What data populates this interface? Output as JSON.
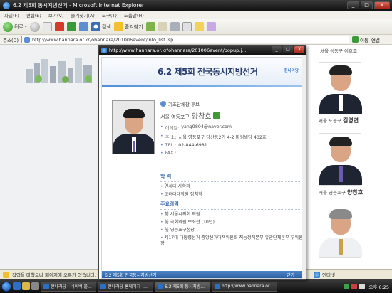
{
  "window": {
    "title": "6.2 제5회 동시지방선거 - Microsoft Internet Explorer",
    "controls": [
      "_",
      "□",
      "X"
    ]
  },
  "menu": [
    "파일(F)",
    "편집(E)",
    "보기(V)",
    "즐겨찾기(A)",
    "도구(T)",
    "도움말(H)"
  ],
  "toolbar": {
    "back_label": "뒤로",
    "search_label": "검색",
    "favorites_label": "즐겨찾기"
  },
  "address": {
    "label": "주소(D)",
    "url": "http://www.hannara.or.kr/ohannara/201006event/info_list.jsp",
    "go_label": "이동",
    "links_label": "연결"
  },
  "right_panel": {
    "top_caption": "서울 성동구 이호조",
    "candidates": [
      {
        "region": "서울 도봉구",
        "name": "김영련"
      },
      {
        "region": "서울 영등포구",
        "name": "양창호"
      },
      {
        "region": "",
        "name": ""
      }
    ]
  },
  "status": {
    "text": "작업을 마쳤으나 페이지에 오류가 있습니다.",
    "zone": "인터넷"
  },
  "taskbar": {
    "tasks": [
      "한나라당 - 네이버 블...",
      "한나라당 홈페이지 -...",
      "6.2 제5회 동시지방...",
      "http://www.hannara.or..."
    ],
    "clock": "오후 6:25"
  },
  "popup": {
    "url": "http://www.hannara.or.kr/ohannara/201006event/popup.j...",
    "header": {
      "date": "6.2",
      "title_rest": "제5회 전국동시지방선거",
      "party": "한나라당"
    },
    "candidate": {
      "category": "기초단체장 후보",
      "region": "서울 영등포구",
      "name": "양창호",
      "email_label": "이메일:",
      "email": "yang9804@naver.com",
      "address_label": "주  소:",
      "address": "서울 영등포구 당산동2가 4-2 마림빌딩 402호",
      "tel_label": "TEL :",
      "tel": "02-844-6981",
      "fax_label": "FAX :",
      "fax": ""
    },
    "education": {
      "heading": "학  력",
      "items": [
        "연세대 사학과",
        "고려대대학원 정치학"
      ]
    },
    "career": {
      "heading": "주요경력",
      "items": [
        "前 서울시의회 의원",
        "前 국회의원 보좌관 (10년)",
        "前 영등포구청장",
        "제17대 대통령선거 중앙선거대책위원회 직능정책본부 유관단체본부 부위원장"
      ]
    },
    "footer": {
      "text": "6.2 제5회 전국동시지방선거",
      "close_label": "닫기"
    }
  }
}
